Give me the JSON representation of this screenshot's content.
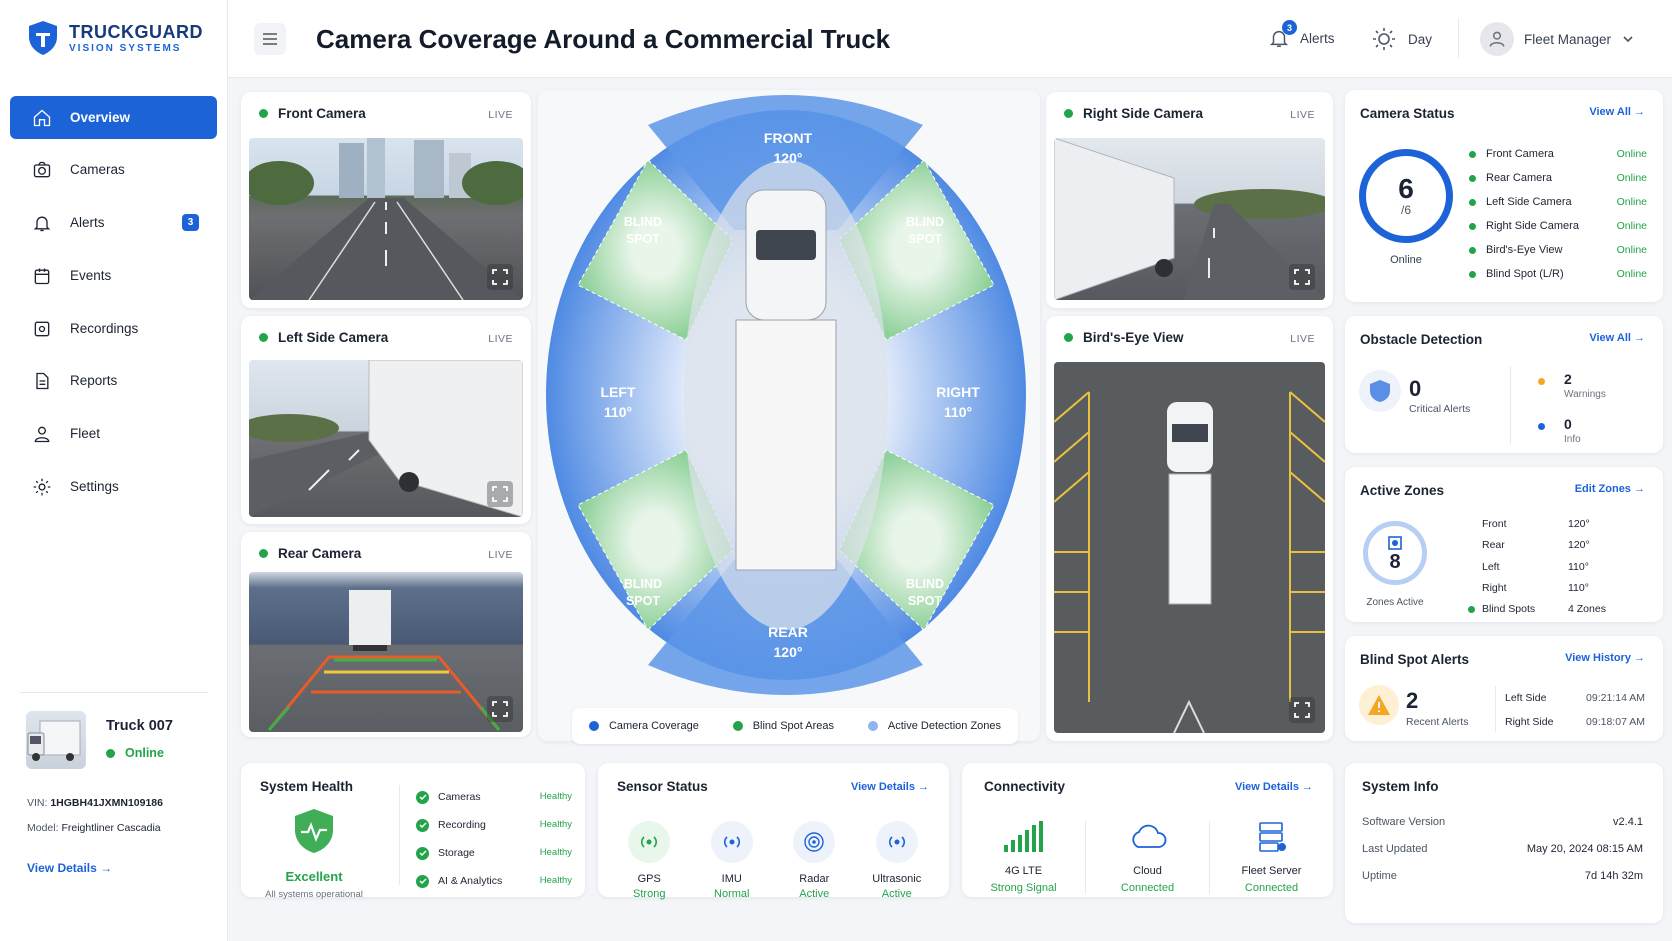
{
  "brand": {
    "name": "TRUCKGUARD",
    "tagline": "VISION SYSTEMS"
  },
  "header": {
    "title": "Camera Coverage Around a Commercial Truck",
    "alerts_label": "Alerts",
    "alerts_count": "3",
    "mode_label": "Day",
    "user_label": "Fleet Manager"
  },
  "nav": [
    {
      "label": "Overview"
    },
    {
      "label": "Cameras"
    },
    {
      "label": "Alerts",
      "badge": "3"
    },
    {
      "label": "Events"
    },
    {
      "label": "Recordings"
    },
    {
      "label": "Reports"
    },
    {
      "label": "Fleet"
    },
    {
      "label": "Settings"
    }
  ],
  "truck": {
    "name": "Truck 007",
    "status": "Online",
    "vin_label": "VIN:",
    "vin": "1HGBH41JXMN109186",
    "model_label": "Model:",
    "model": "Freightliner Cascadia",
    "details_link": "View Details"
  },
  "cameras": {
    "front": {
      "title": "Front Camera",
      "live": "LIVE"
    },
    "left": {
      "title": "Left Side Camera",
      "live": "LIVE"
    },
    "rear": {
      "title": "Rear Camera",
      "live": "LIVE"
    },
    "right": {
      "title": "Right Side Camera",
      "live": "LIVE"
    },
    "birds": {
      "title": "Bird's-Eye View",
      "live": "LIVE"
    }
  },
  "coverage": {
    "front": {
      "label": "FRONT",
      "angle": "120°"
    },
    "rear": {
      "label": "REAR",
      "angle": "120°"
    },
    "left": {
      "label": "LEFT",
      "angle": "110°"
    },
    "right": {
      "label": "RIGHT",
      "angle": "110°"
    },
    "blind_line1": "BLIND",
    "blind_line2": "SPOT",
    "legend": {
      "coverage": "Camera Coverage",
      "blind": "Blind Spot Areas",
      "active": "Active Detection Zones"
    },
    "colors": {
      "coverage": "#1d63d8",
      "blind": "#23a34a",
      "active": "#8fb3ef"
    }
  },
  "camera_status": {
    "title": "Camera Status",
    "link": "View All",
    "online_count": "6",
    "total": "/6",
    "online_label": "Online",
    "items": [
      {
        "name": "Front Camera",
        "status": "Online"
      },
      {
        "name": "Rear Camera",
        "status": "Online"
      },
      {
        "name": "Left Side Camera",
        "status": "Online"
      },
      {
        "name": "Right Side Camera",
        "status": "Online"
      },
      {
        "name": "Bird's-Eye View",
        "status": "Online"
      },
      {
        "name": "Blind Spot (L/R)",
        "status": "Online"
      }
    ]
  },
  "obstacle": {
    "title": "Obstacle Detection",
    "link": "View All",
    "critical_count": "0",
    "critical_label": "Critical Alerts",
    "warnings_count": "2",
    "warnings_label": "Warnings",
    "info_count": "0",
    "info_label": "Info"
  },
  "zones": {
    "title": "Active Zones",
    "link": "Edit Zones",
    "count": "8",
    "count_label": "Zones Active",
    "items": [
      {
        "name": "Front",
        "value": "120°"
      },
      {
        "name": "Rear",
        "value": "120°"
      },
      {
        "name": "Left",
        "value": "110°"
      },
      {
        "name": "Right",
        "value": "110°"
      },
      {
        "name": "Blind Spots",
        "value": "4 Zones"
      }
    ]
  },
  "blind_alerts": {
    "title": "Blind Spot Alerts",
    "link": "View History",
    "count": "2",
    "count_label": "Recent Alerts",
    "items": [
      {
        "side": "Left Side",
        "time": "09:21:14 AM"
      },
      {
        "side": "Right Side",
        "time": "09:18:07 AM"
      }
    ]
  },
  "health": {
    "title": "System Health",
    "status": "Excellent",
    "sub": "All systems operational",
    "items": [
      {
        "name": "Cameras",
        "status": "Healthy"
      },
      {
        "name": "Recording",
        "status": "Healthy"
      },
      {
        "name": "Storage",
        "status": "Healthy"
      },
      {
        "name": "AI & Analytics",
        "status": "Healthy"
      }
    ]
  },
  "sensors": {
    "title": "Sensor Status",
    "link": "View Details",
    "items": [
      {
        "name": "GPS",
        "status": "Strong"
      },
      {
        "name": "IMU",
        "status": "Normal"
      },
      {
        "name": "Radar",
        "status": "Active"
      },
      {
        "name": "Ultrasonic",
        "status": "Active"
      }
    ]
  },
  "connectivity": {
    "title": "Connectivity",
    "link": "View Details",
    "items": [
      {
        "name": "4G LTE",
        "status": "Strong Signal"
      },
      {
        "name": "Cloud",
        "status": "Connected"
      },
      {
        "name": "Fleet Server",
        "status": "Connected"
      }
    ]
  },
  "sysinfo": {
    "title": "System Info",
    "items": [
      {
        "label": "Software Version",
        "value": "v2.4.1"
      },
      {
        "label": "Last Updated",
        "value": "May 20, 2024 08:15 AM"
      },
      {
        "label": "Uptime",
        "value": "7d 14h 32m"
      }
    ]
  }
}
